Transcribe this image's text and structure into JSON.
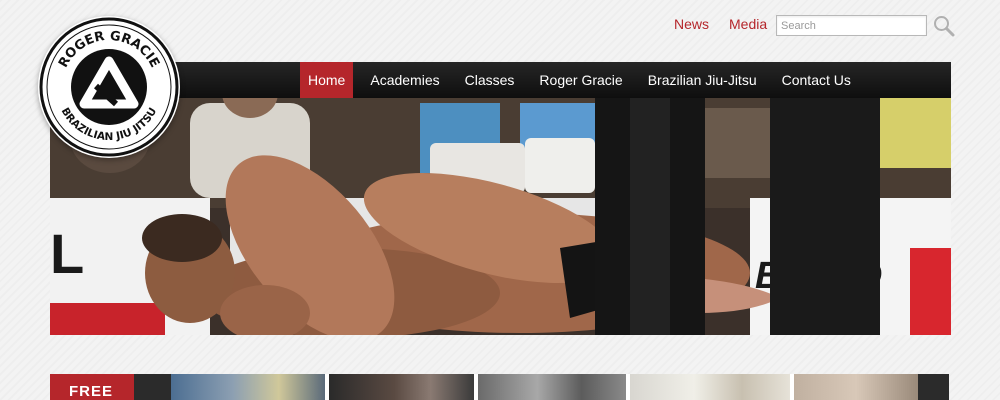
{
  "header": {
    "links": [
      "News",
      "Media"
    ],
    "search": {
      "placeholder": "Search",
      "value": ""
    }
  },
  "logo": {
    "text_top": "ROGER GRACIE",
    "text_bottom": "BRAZILIAN JIU JITSU"
  },
  "nav": {
    "items": [
      "Home",
      "Academies",
      "Classes",
      "Roger Gracie",
      "Brazilian Jiu-Jitsu",
      "Contact Us"
    ],
    "active": "Home"
  },
  "hero": {
    "description": "Two grapplers in a jiu-jitsu match with a referee standing in front of a crowd"
  },
  "promo": {
    "tab_label": "FREE"
  },
  "colors": {
    "accent": "#b5262b",
    "nav_bg": "#111111",
    "page_bg": "#f3f3f3"
  }
}
